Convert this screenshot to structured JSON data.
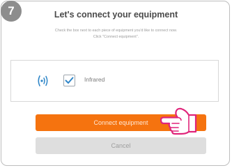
{
  "step": {
    "number": "7"
  },
  "dialog": {
    "title": "Let's connect your equipment",
    "instruction_line1": "Check the box next to each piece of equipment you'd like to connect now.",
    "instruction_line2": "Click \"Connect equipment\"."
  },
  "equipment": [
    {
      "label": "Infrared",
      "checked": true,
      "icon": "infrared-signal-icon"
    }
  ],
  "buttons": {
    "connect_label": "Connect equipment",
    "cancel_label": "Cancel"
  },
  "colors": {
    "accent": "#f5730f",
    "checkmark": "#2f86c8",
    "badge": "#8d8d8d",
    "cancel_bg": "#dedede"
  },
  "overlay": {
    "pointer": "pointing-hand-icon"
  }
}
